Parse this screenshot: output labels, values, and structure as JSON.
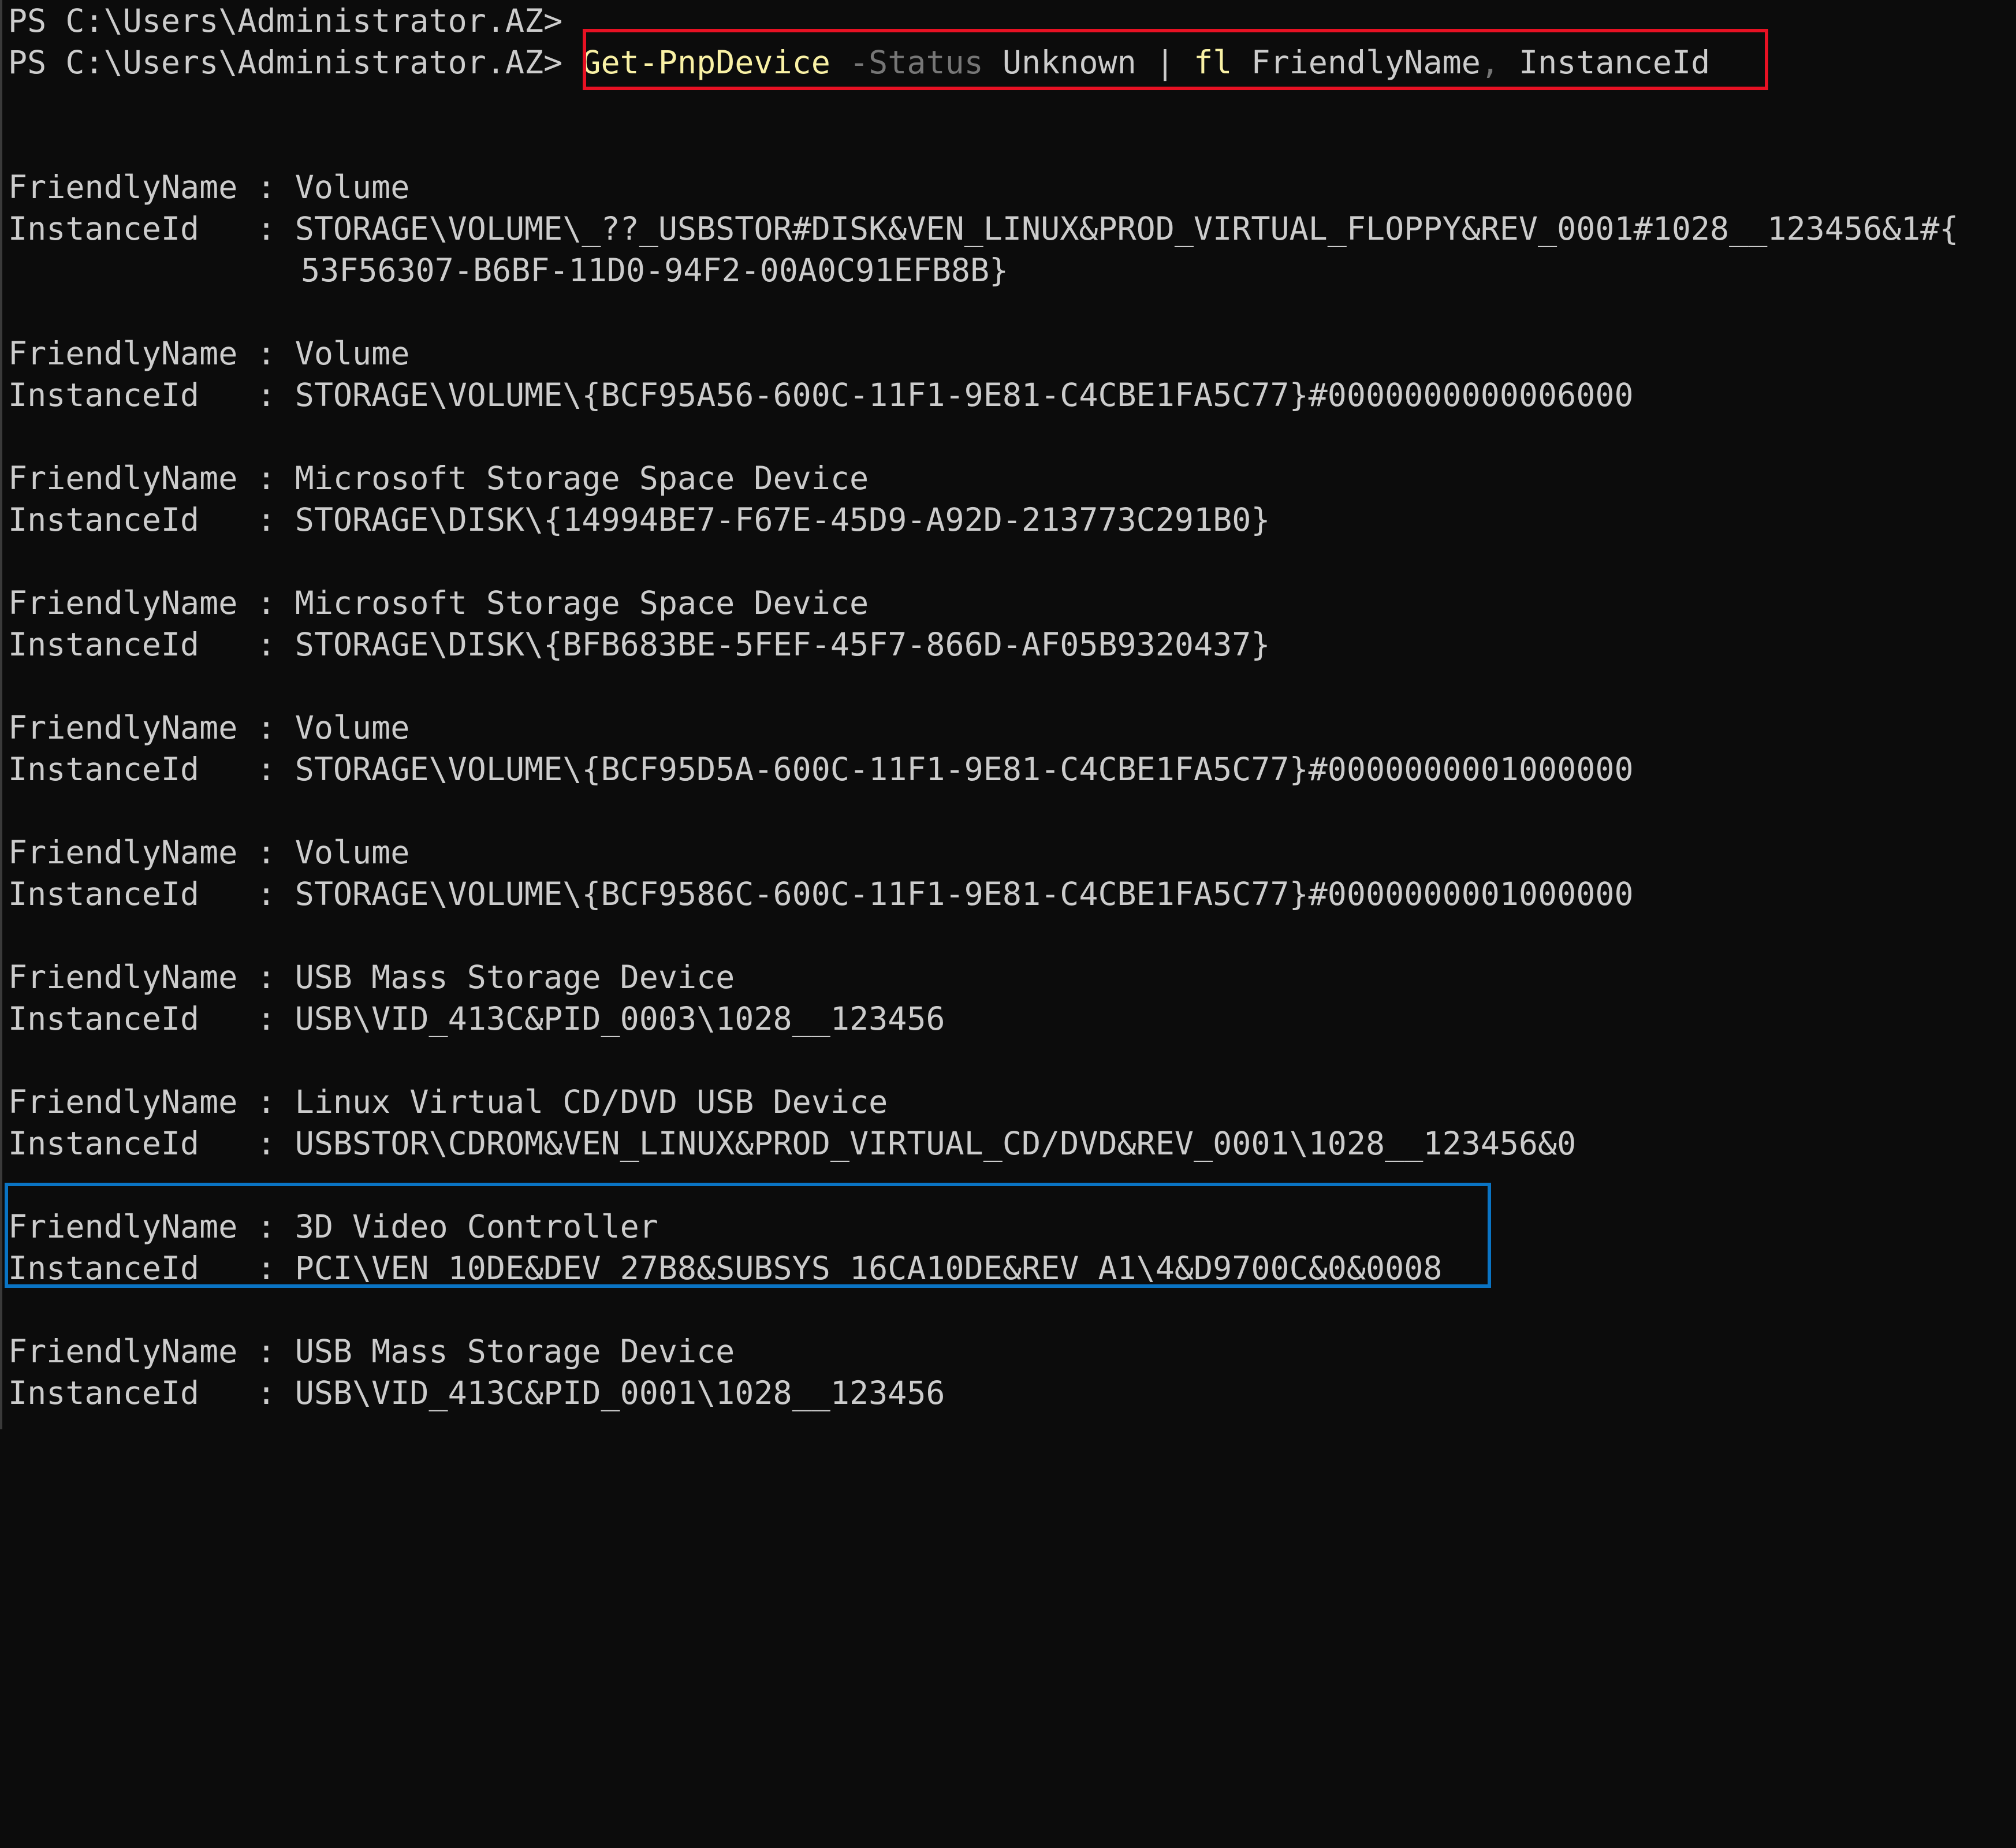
{
  "prompt": "PS C:\\Users\\Administrator.AZ>",
  "command": {
    "cmdlet": "Get-PnpDevice",
    "param": "-Status",
    "arg": "Unknown",
    "pipe": "|",
    "alias": "fl",
    "prop1": "FriendlyName",
    "comma": ",",
    "prop2": "InstanceId"
  },
  "labels": {
    "friendly": "FriendlyName : ",
    "instance": "InstanceId   : "
  },
  "devices": [
    {
      "friendly_name": "Volume",
      "instance_id": "STORAGE\\VOLUME\\_??_USBSTOR#DISK&VEN_LINUX&PROD_VIRTUAL_FLOPPY&REV_0001#1028__123456&1#{",
      "instance_id_cont": "53F56307-B6BF-11D0-94F2-00A0C91EFB8B}"
    },
    {
      "friendly_name": "Volume",
      "instance_id": "STORAGE\\VOLUME\\{BCF95A56-600C-11F1-9E81-C4CBE1FA5C77}#0000000000006000"
    },
    {
      "friendly_name": "Microsoft Storage Space Device",
      "instance_id": "STORAGE\\DISK\\{14994BE7-F67E-45D9-A92D-213773C291B0}"
    },
    {
      "friendly_name": "Microsoft Storage Space Device",
      "instance_id": "STORAGE\\DISK\\{BFB683BE-5FEF-45F7-866D-AF05B9320437}"
    },
    {
      "friendly_name": "Volume",
      "instance_id": "STORAGE\\VOLUME\\{BCF95D5A-600C-11F1-9E81-C4CBE1FA5C77}#0000000001000000"
    },
    {
      "friendly_name": "Volume",
      "instance_id": "STORAGE\\VOLUME\\{BCF9586C-600C-11F1-9E81-C4CBE1FA5C77}#0000000001000000"
    },
    {
      "friendly_name": "USB Mass Storage Device",
      "instance_id": "USB\\VID_413C&PID_0003\\1028__123456"
    },
    {
      "friendly_name": "Linux Virtual CD/DVD USB Device",
      "instance_id": "USBSTOR\\CDROM&VEN_LINUX&PROD_VIRTUAL_CD/DVD&REV_0001\\1028__123456&0"
    },
    {
      "friendly_name": "3D Video Controller",
      "instance_id": "PCI\\VEN_10DE&DEV_27B8&SUBSYS_16CA10DE&REV_A1\\4&D9700C&0&0008"
    },
    {
      "friendly_name": "USB Mass Storage Device",
      "instance_id": "USB\\VID_413C&PID_0001\\1028__123456"
    }
  ],
  "highlight_colors": {
    "command_box": "#e81123",
    "device_box": "#0a74c4"
  }
}
